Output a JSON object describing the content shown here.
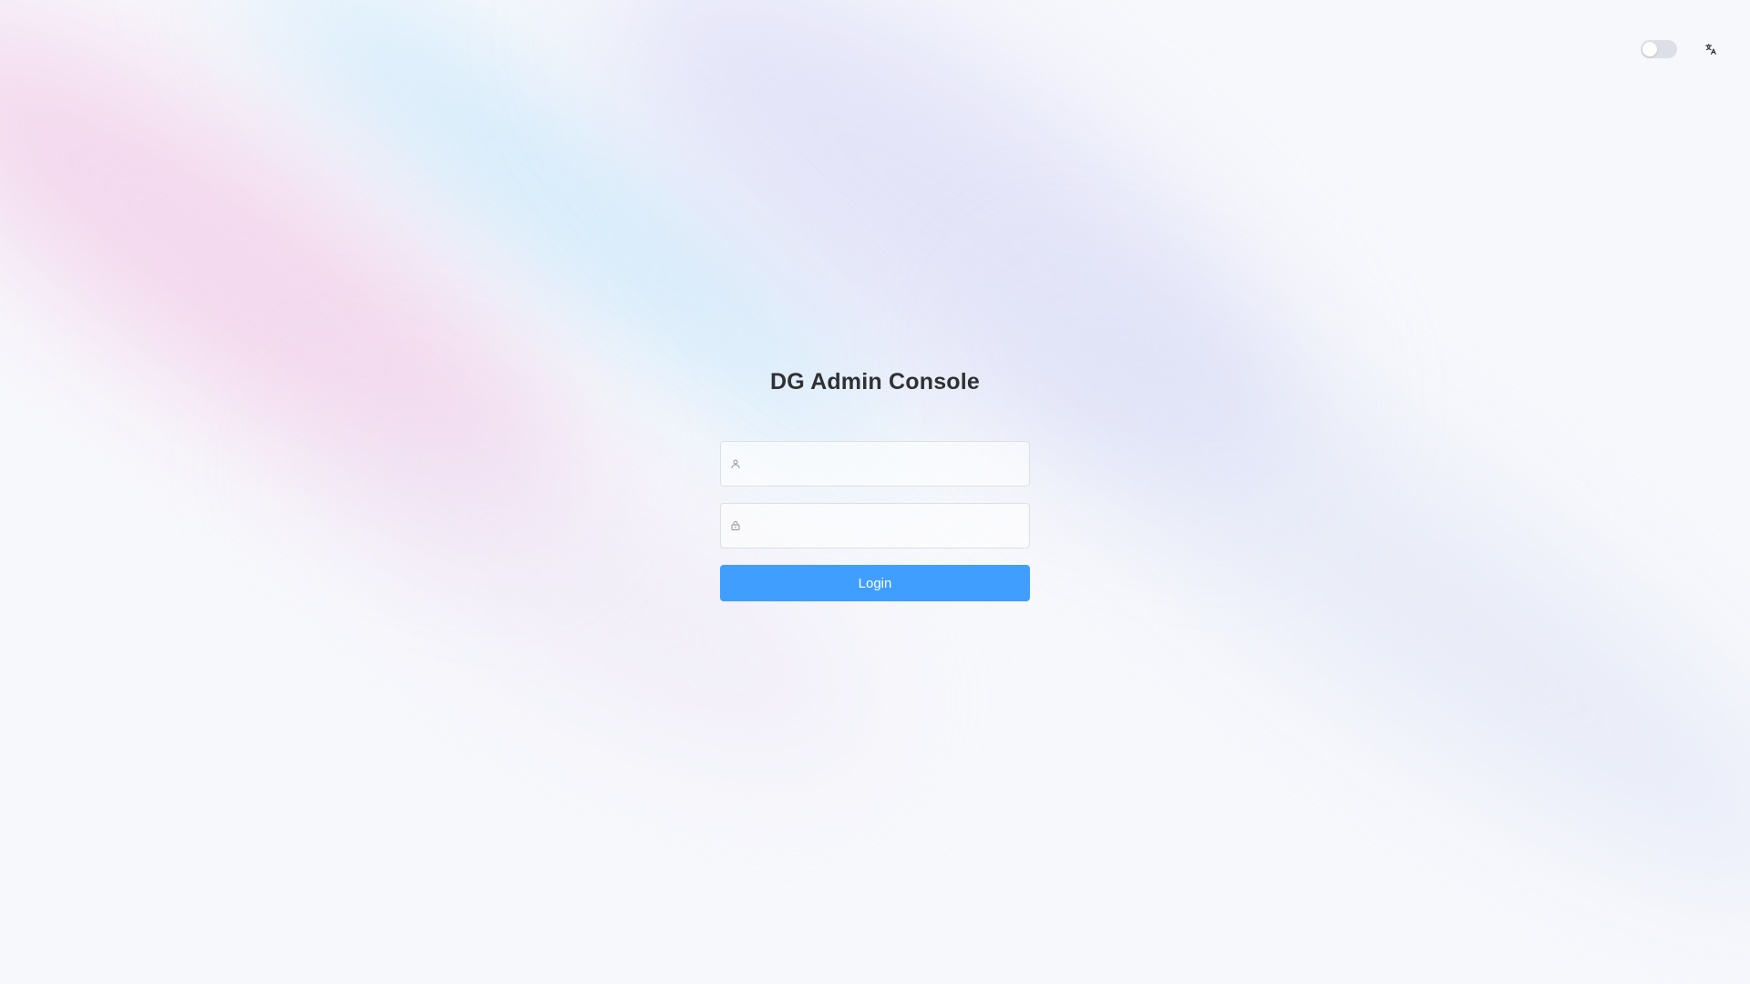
{
  "app": {
    "title": "DG Admin Console"
  },
  "topbar": {
    "theme_toggle": {
      "state": "off",
      "icon": "toggle-switch"
    },
    "language_icon": "translate-icon"
  },
  "form": {
    "username": {
      "value": "",
      "placeholder": "",
      "icon": "user-icon"
    },
    "password": {
      "value": "",
      "placeholder": "",
      "icon": "lock-icon"
    },
    "submit_label": "Login"
  },
  "colors": {
    "primary": "#409eff",
    "title_text": "#303133",
    "input_border": "#dcdfe6",
    "icon_gray": "#909399"
  }
}
